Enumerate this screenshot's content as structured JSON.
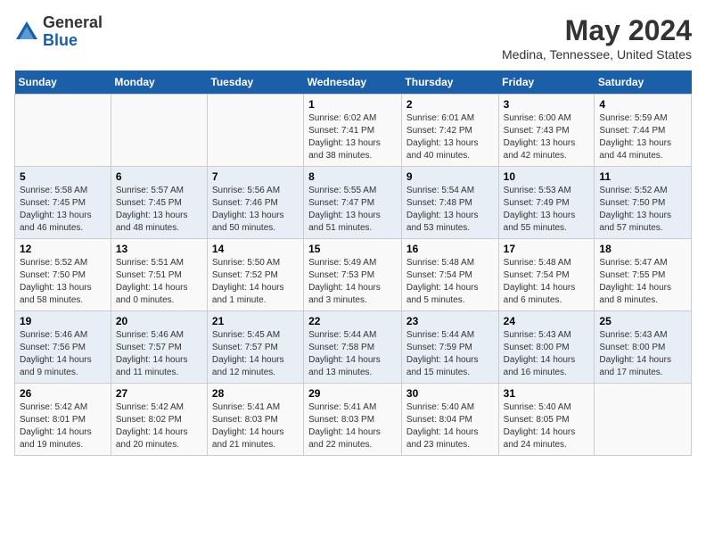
{
  "header": {
    "logo_line1": "General",
    "logo_line2": "Blue",
    "title": "May 2024",
    "subtitle": "Medina, Tennessee, United States"
  },
  "days_of_week": [
    "Sunday",
    "Monday",
    "Tuesday",
    "Wednesday",
    "Thursday",
    "Friday",
    "Saturday"
  ],
  "weeks": [
    [
      {
        "day": "",
        "info": ""
      },
      {
        "day": "",
        "info": ""
      },
      {
        "day": "",
        "info": ""
      },
      {
        "day": "1",
        "info": "Sunrise: 6:02 AM\nSunset: 7:41 PM\nDaylight: 13 hours\nand 38 minutes."
      },
      {
        "day": "2",
        "info": "Sunrise: 6:01 AM\nSunset: 7:42 PM\nDaylight: 13 hours\nand 40 minutes."
      },
      {
        "day": "3",
        "info": "Sunrise: 6:00 AM\nSunset: 7:43 PM\nDaylight: 13 hours\nand 42 minutes."
      },
      {
        "day": "4",
        "info": "Sunrise: 5:59 AM\nSunset: 7:44 PM\nDaylight: 13 hours\nand 44 minutes."
      }
    ],
    [
      {
        "day": "5",
        "info": "Sunrise: 5:58 AM\nSunset: 7:45 PM\nDaylight: 13 hours\nand 46 minutes."
      },
      {
        "day": "6",
        "info": "Sunrise: 5:57 AM\nSunset: 7:45 PM\nDaylight: 13 hours\nand 48 minutes."
      },
      {
        "day": "7",
        "info": "Sunrise: 5:56 AM\nSunset: 7:46 PM\nDaylight: 13 hours\nand 50 minutes."
      },
      {
        "day": "8",
        "info": "Sunrise: 5:55 AM\nSunset: 7:47 PM\nDaylight: 13 hours\nand 51 minutes."
      },
      {
        "day": "9",
        "info": "Sunrise: 5:54 AM\nSunset: 7:48 PM\nDaylight: 13 hours\nand 53 minutes."
      },
      {
        "day": "10",
        "info": "Sunrise: 5:53 AM\nSunset: 7:49 PM\nDaylight: 13 hours\nand 55 minutes."
      },
      {
        "day": "11",
        "info": "Sunrise: 5:52 AM\nSunset: 7:50 PM\nDaylight: 13 hours\nand 57 minutes."
      }
    ],
    [
      {
        "day": "12",
        "info": "Sunrise: 5:52 AM\nSunset: 7:50 PM\nDaylight: 13 hours\nand 58 minutes."
      },
      {
        "day": "13",
        "info": "Sunrise: 5:51 AM\nSunset: 7:51 PM\nDaylight: 14 hours\nand 0 minutes."
      },
      {
        "day": "14",
        "info": "Sunrise: 5:50 AM\nSunset: 7:52 PM\nDaylight: 14 hours\nand 1 minute."
      },
      {
        "day": "15",
        "info": "Sunrise: 5:49 AM\nSunset: 7:53 PM\nDaylight: 14 hours\nand 3 minutes."
      },
      {
        "day": "16",
        "info": "Sunrise: 5:48 AM\nSunset: 7:54 PM\nDaylight: 14 hours\nand 5 minutes."
      },
      {
        "day": "17",
        "info": "Sunrise: 5:48 AM\nSunset: 7:54 PM\nDaylight: 14 hours\nand 6 minutes."
      },
      {
        "day": "18",
        "info": "Sunrise: 5:47 AM\nSunset: 7:55 PM\nDaylight: 14 hours\nand 8 minutes."
      }
    ],
    [
      {
        "day": "19",
        "info": "Sunrise: 5:46 AM\nSunset: 7:56 PM\nDaylight: 14 hours\nand 9 minutes."
      },
      {
        "day": "20",
        "info": "Sunrise: 5:46 AM\nSunset: 7:57 PM\nDaylight: 14 hours\nand 11 minutes."
      },
      {
        "day": "21",
        "info": "Sunrise: 5:45 AM\nSunset: 7:57 PM\nDaylight: 14 hours\nand 12 minutes."
      },
      {
        "day": "22",
        "info": "Sunrise: 5:44 AM\nSunset: 7:58 PM\nDaylight: 14 hours\nand 13 minutes."
      },
      {
        "day": "23",
        "info": "Sunrise: 5:44 AM\nSunset: 7:59 PM\nDaylight: 14 hours\nand 15 minutes."
      },
      {
        "day": "24",
        "info": "Sunrise: 5:43 AM\nSunset: 8:00 PM\nDaylight: 14 hours\nand 16 minutes."
      },
      {
        "day": "25",
        "info": "Sunrise: 5:43 AM\nSunset: 8:00 PM\nDaylight: 14 hours\nand 17 minutes."
      }
    ],
    [
      {
        "day": "26",
        "info": "Sunrise: 5:42 AM\nSunset: 8:01 PM\nDaylight: 14 hours\nand 19 minutes."
      },
      {
        "day": "27",
        "info": "Sunrise: 5:42 AM\nSunset: 8:02 PM\nDaylight: 14 hours\nand 20 minutes."
      },
      {
        "day": "28",
        "info": "Sunrise: 5:41 AM\nSunset: 8:03 PM\nDaylight: 14 hours\nand 21 minutes."
      },
      {
        "day": "29",
        "info": "Sunrise: 5:41 AM\nSunset: 8:03 PM\nDaylight: 14 hours\nand 22 minutes."
      },
      {
        "day": "30",
        "info": "Sunrise: 5:40 AM\nSunset: 8:04 PM\nDaylight: 14 hours\nand 23 minutes."
      },
      {
        "day": "31",
        "info": "Sunrise: 5:40 AM\nSunset: 8:05 PM\nDaylight: 14 hours\nand 24 minutes."
      },
      {
        "day": "",
        "info": ""
      }
    ]
  ]
}
